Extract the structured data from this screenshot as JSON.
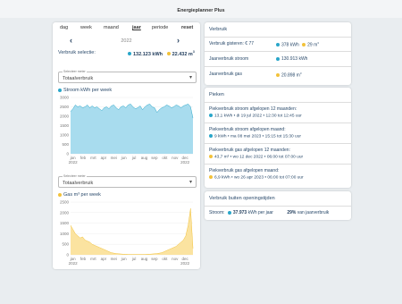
{
  "app": {
    "title": "Energieplanner Plus"
  },
  "tabs": [
    "dag",
    "week",
    "maand",
    "jaar",
    "periode",
    "reset"
  ],
  "period": {
    "year": "2022"
  },
  "selection": {
    "label": "Verbruik selectie:",
    "stroom": "132.123 kWh",
    "gas": "22.432 m",
    "gas_sup": "3"
  },
  "selectors": [
    {
      "label": "Selecteer meter",
      "value": "Totaalverbruik"
    },
    {
      "label": "Selecteer meter",
      "value": "Totaalverbruik"
    }
  ],
  "charts": {
    "stroom_title": "Stroom kWh per week",
    "gas_title": "Gas m³ per week"
  },
  "chart_data": [
    {
      "type": "area",
      "title": "Stroom kWh per week",
      "x": [
        "jan 2022",
        "feb",
        "mrt",
        "apr",
        "mei",
        "jun",
        "jul",
        "aug",
        "sep",
        "okt",
        "nov",
        "dec 2022"
      ],
      "values": [
        2250,
        2400,
        2600,
        2500,
        2550,
        2450,
        2500,
        2600,
        2450,
        2550,
        2450,
        2500,
        2400,
        2300,
        2450,
        2500,
        2400,
        2550,
        2600,
        2450,
        2350,
        2500,
        2550,
        2450,
        2600,
        2650,
        2500,
        2400,
        2450,
        2550,
        2350,
        2500,
        2600,
        2650,
        2500,
        2450,
        2200,
        2350,
        2450,
        2500,
        2600,
        2550,
        2450,
        2500,
        2600,
        2550,
        2450,
        2550,
        2600,
        2650,
        2500,
        1900
      ],
      "ylim": [
        0,
        3000
      ],
      "yticks": [
        0,
        500,
        1000,
        1500,
        2000,
        2500,
        3000
      ],
      "color": "#a8dcee",
      "stroke": "#29a6c9"
    },
    {
      "type": "area",
      "title": "Gas m³ per week",
      "x": [
        "jan 2022",
        "feb",
        "mrt",
        "apr",
        "mei",
        "jun",
        "jul",
        "aug",
        "sep",
        "okt",
        "nov",
        "dec 2022"
      ],
      "values": [
        1400,
        1200,
        1000,
        900,
        800,
        850,
        700,
        650,
        600,
        500,
        450,
        400,
        350,
        300,
        250,
        200,
        150,
        100,
        80,
        60,
        50,
        40,
        30,
        30,
        20,
        20,
        20,
        20,
        20,
        20,
        20,
        20,
        30,
        30,
        40,
        50,
        60,
        80,
        100,
        150,
        200,
        250,
        300,
        350,
        400,
        500,
        600,
        700,
        900,
        1400,
        2200,
        300
      ],
      "ylim": [
        0,
        2500
      ],
      "yticks": [
        0,
        500,
        1000,
        1500,
        2000,
        2500
      ],
      "color": "#fbe3a0",
      "stroke": "#f2c23a"
    }
  ],
  "verbruik": {
    "title": "Verbruik",
    "rows": [
      {
        "label": "Verbruik gisteren: € 77",
        "stroom": "378 kWh",
        "gas": "29 m",
        "gas_sup": "3"
      },
      {
        "label": "Jaarverbruik stroom",
        "stroom": "130.913 kWh"
      },
      {
        "label": "Jaarverbruik gas",
        "gas": "20.898 m",
        "gas_sup": "3"
      }
    ]
  },
  "pieken": {
    "title": "Pieken",
    "items": [
      {
        "label": "Piekverbruik stroom afgelopen 12 maanden:",
        "value": "13,1 kWh • di 19 jul 2022 • 12:30 tot 12:45 uur",
        "color": "blue"
      },
      {
        "label": "Piekverbruik stroom afgelopen maand:",
        "value": "9 kWh • ma 08 mei 2023 • 15:15 tot 15:30 uur",
        "color": "blue"
      },
      {
        "label": "Piekverbruik gas afgelopen 12 maanden:",
        "value": "43,7 m³ • wo 12 dec 2022 • 06:00 tot 07:00 uur",
        "color": "yellow"
      },
      {
        "label": "Piekverbruik gas afgelopen maand:",
        "value": "6,9 kWh • wo 26 apr 2023 • 06:00 tot 07:00 uur",
        "color": "yellow"
      }
    ]
  },
  "buiten": {
    "title": "Verbruik buiten openingstijden",
    "label": "Stroom:",
    "value": "37.973",
    "unit": "kWh per jaar",
    "percent": "29%",
    "percent_label": "van jaarverbruik"
  }
}
